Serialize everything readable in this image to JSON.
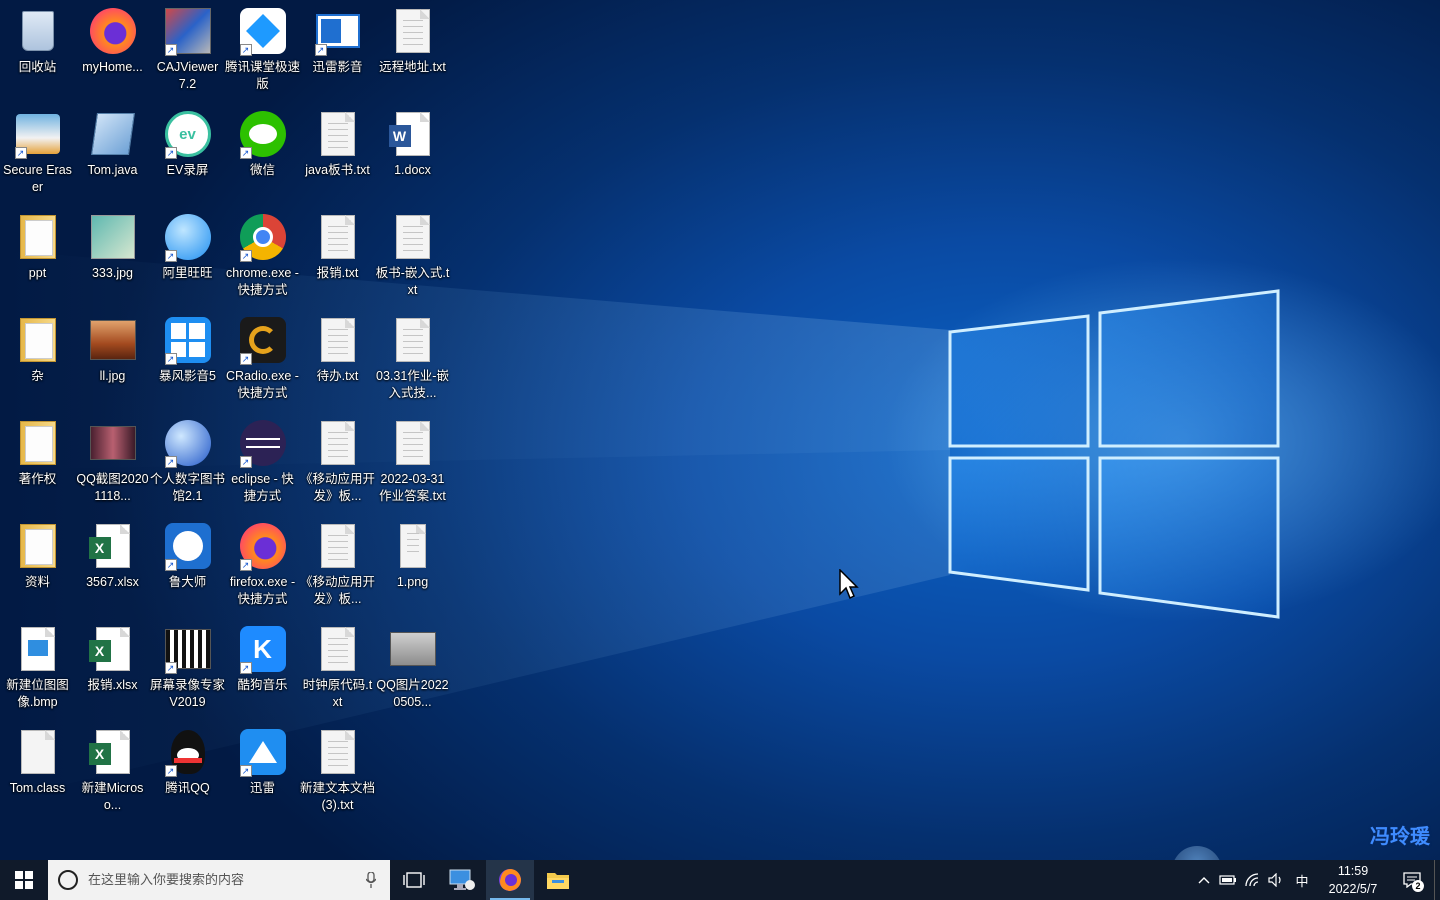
{
  "desktop": {
    "icons": [
      {
        "label": "回收站",
        "type": "recycle",
        "shortcut": false
      },
      {
        "label": "myHome...",
        "type": "firefox-purple",
        "shortcut": false
      },
      {
        "label": "CAJViewer 7.2",
        "type": "cajviewer",
        "shortcut": true
      },
      {
        "label": "腾讯课堂极速版",
        "type": "tencent-class",
        "shortcut": true
      },
      {
        "label": "迅雷影音",
        "type": "xunlei-player",
        "shortcut": true
      },
      {
        "label": "远程地址.txt",
        "type": "txt",
        "shortcut": false
      },
      {
        "label": "Secure Eraser",
        "type": "secure-eraser",
        "shortcut": true
      },
      {
        "label": "Tom.java",
        "type": "java",
        "shortcut": false
      },
      {
        "label": "EV录屏",
        "type": "ev",
        "shortcut": true
      },
      {
        "label": "微信",
        "type": "wechat",
        "shortcut": true
      },
      {
        "label": "java板书.txt",
        "type": "txt",
        "shortcut": false
      },
      {
        "label": "1.docx",
        "type": "docx",
        "shortcut": false
      },
      {
        "label": "ppt",
        "type": "folder",
        "shortcut": false
      },
      {
        "label": "333.jpg",
        "type": "jpg",
        "shortcut": false
      },
      {
        "label": "阿里旺旺",
        "type": "aliwangwang",
        "shortcut": true
      },
      {
        "label": "chrome.exe - 快捷方式",
        "type": "chrome",
        "shortcut": true
      },
      {
        "label": "报销.txt",
        "type": "txt",
        "shortcut": false
      },
      {
        "label": "板书-嵌入式.txt",
        "type": "txt",
        "shortcut": false
      },
      {
        "label": "杂",
        "type": "folder",
        "shortcut": false
      },
      {
        "label": "ll.jpg",
        "type": "photo",
        "shortcut": false
      },
      {
        "label": "暴风影音5",
        "type": "baofeng",
        "shortcut": true
      },
      {
        "label": "CRadio.exe - 快捷方式",
        "type": "cradio",
        "shortcut": true
      },
      {
        "label": "待办.txt",
        "type": "txt",
        "shortcut": false
      },
      {
        "label": "03.31作业-嵌入式技...",
        "type": "txt",
        "shortcut": false
      },
      {
        "label": "著作权",
        "type": "folder",
        "shortcut": false
      },
      {
        "label": "QQ截图20201118...",
        "type": "photo-dark",
        "shortcut": false
      },
      {
        "label": "个人数字图书馆2.1",
        "type": "globe",
        "shortcut": true
      },
      {
        "label": "eclipse - 快捷方式",
        "type": "eclipse",
        "shortcut": true
      },
      {
        "label": "《移动应用开发》板...",
        "type": "txt",
        "shortcut": false
      },
      {
        "label": "2022-03-31作业答案.txt",
        "type": "txt",
        "shortcut": false
      },
      {
        "label": "资料",
        "type": "folder",
        "shortcut": false
      },
      {
        "label": "3567.xlsx",
        "type": "xlsx",
        "shortcut": false
      },
      {
        "label": "鲁大师",
        "type": "ludashi",
        "shortcut": true
      },
      {
        "label": "firefox.exe - 快捷方式",
        "type": "firefox",
        "shortcut": true
      },
      {
        "label": "《移动应用开发》板...",
        "type": "txt",
        "shortcut": false
      },
      {
        "label": "1.png",
        "type": "png",
        "shortcut": false
      },
      {
        "label": "新建位图图像.bmp",
        "type": "bmp",
        "shortcut": false
      },
      {
        "label": "报销.xlsx",
        "type": "xlsx",
        "shortcut": false
      },
      {
        "label": "屏幕录像专家V2019",
        "type": "recorder",
        "shortcut": true
      },
      {
        "label": "酷狗音乐",
        "type": "kugou",
        "shortcut": true
      },
      {
        "label": "时钟原代码.txt",
        "type": "txt",
        "shortcut": false
      },
      {
        "label": "QQ图片20220505...",
        "type": "photo-gray",
        "shortcut": false
      },
      {
        "label": "Tom.class",
        "type": "blank",
        "shortcut": false
      },
      {
        "label": "新建Microso...",
        "type": "xlsx",
        "shortcut": false
      },
      {
        "label": "腾讯QQ",
        "type": "qq",
        "shortcut": true
      },
      {
        "label": "迅雷",
        "type": "xunlei",
        "shortcut": true
      },
      {
        "label": "新建文本文档 (3).txt",
        "type": "txt",
        "shortcut": false
      }
    ],
    "watermark": "冯玲瑗"
  },
  "taskbar": {
    "search_placeholder": "在这里输入你要搜索的内容",
    "pinned": [
      {
        "name": "remote-desktop",
        "active": false
      },
      {
        "name": "firefox",
        "active": true
      },
      {
        "name": "file-explorer",
        "active": false
      }
    ],
    "tray": {
      "ime": "中",
      "time": "11:59",
      "date": "2022/5/7",
      "notifications": "2"
    }
  },
  "colors": {
    "taskbar": "#101a2a",
    "wallpaper_blue": "#0a4aa3",
    "accent": "#76b9ed"
  }
}
